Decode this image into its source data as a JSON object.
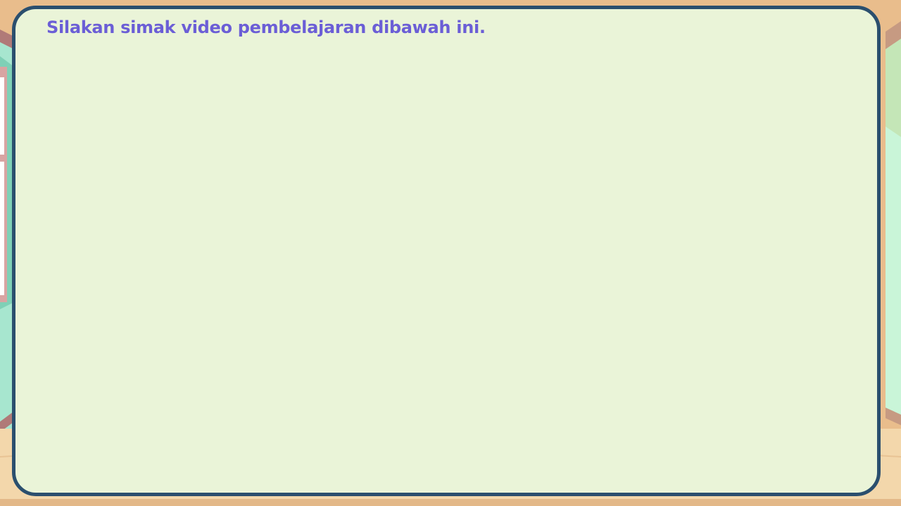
{
  "slide": {
    "instruction": "Silakan simak video pembelajaran dibawah ini."
  },
  "colors": {
    "background_floor": "#e9bd8c",
    "wall_mint": "#7fd0b6",
    "wall_light_green": "#c9f5d8",
    "board_fill": "#eaf4d8",
    "board_border": "#2b4f6e",
    "instruction_text": "#6b5ed6"
  }
}
